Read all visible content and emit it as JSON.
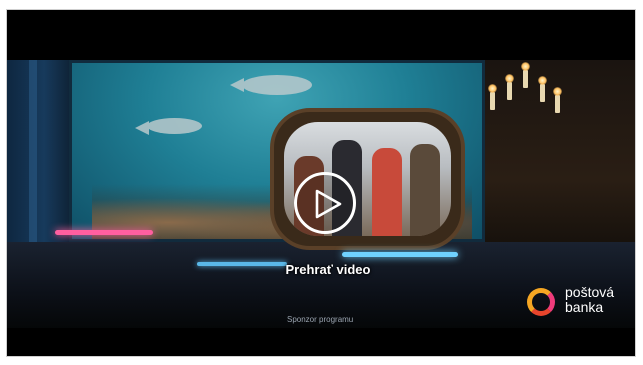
{
  "video": {
    "play_label": "Prehrať video",
    "sponsor_text": "Sponzor programu",
    "play_icon": "play-icon"
  },
  "sponsor_logo": {
    "line1": "poštová",
    "line2": "banka",
    "colors": {
      "ring_top": "#f5a623",
      "ring_right": "#ef3b7b",
      "ring_bottom": "#e8452c"
    }
  }
}
